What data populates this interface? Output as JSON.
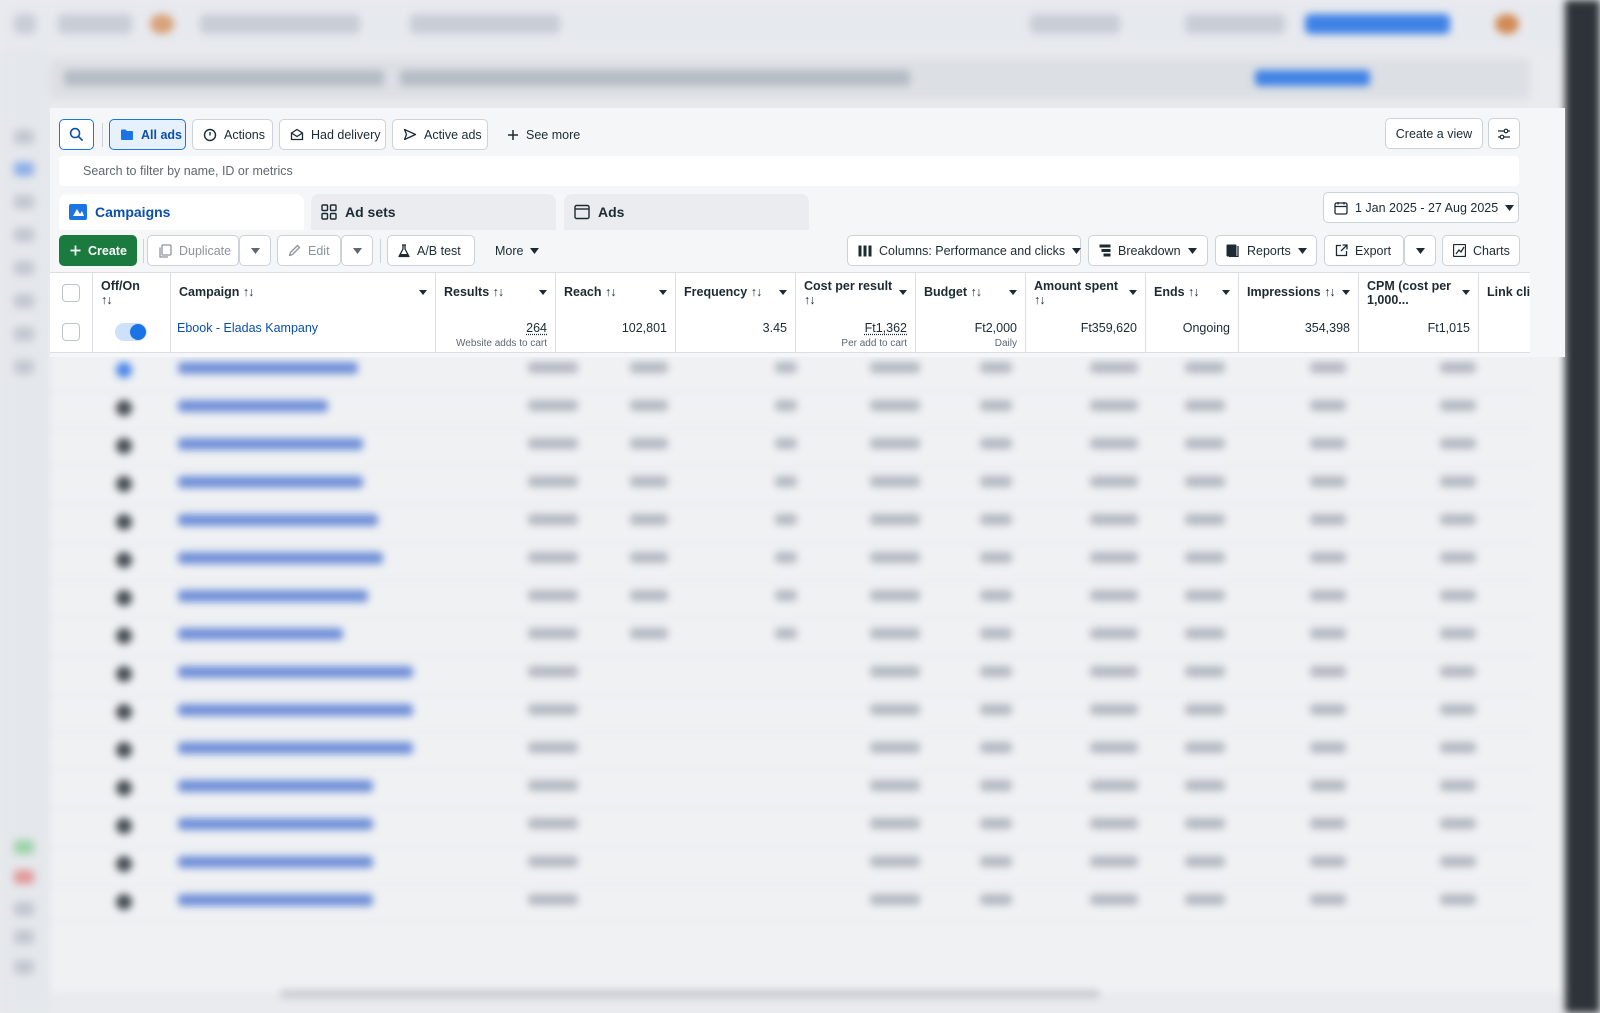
{
  "toolbar": {
    "all_ads": "All ads",
    "actions": "Actions",
    "had_delivery": "Had delivery",
    "active_ads": "Active ads",
    "see_more": "See more",
    "create_view": "Create a view"
  },
  "search": {
    "placeholder": "Search to filter by name, ID or metrics"
  },
  "tabs": {
    "campaigns": "Campaigns",
    "ad_sets": "Ad sets",
    "ads": "Ads"
  },
  "date_range": "1 Jan 2025 - 27 Aug 2025",
  "actions_bar": {
    "create": "Create",
    "duplicate": "Duplicate",
    "edit": "Edit",
    "ab_test": "A/B test",
    "more": "More",
    "columns": "Columns: Performance and clicks",
    "breakdown": "Breakdown",
    "reports": "Reports",
    "export": "Export",
    "charts": "Charts"
  },
  "table": {
    "headers": {
      "offon_1": "Off/On",
      "campaign": "Campaign",
      "results": "Results",
      "reach": "Reach",
      "frequency": "Frequency",
      "cost_per_result": "Cost per result",
      "budget": "Budget",
      "amount_spent": "Amount spent",
      "ends": "Ends",
      "impressions": "Impressions",
      "cpm_1": "CPM (cost per",
      "cpm_2": "1,000...",
      "link_clicks": "Link clic"
    },
    "row": {
      "toggle_on": true,
      "campaign": "Ebook - Eladas Kampany",
      "results": "264",
      "results_sub": "Website adds to cart",
      "reach": "102,801",
      "frequency": "3.45",
      "cost_per_result": "Ft1,362",
      "cost_per_result_sub": "Per add to cart",
      "budget": "Ft2,000",
      "budget_sub": "Daily",
      "amount_spent": "Ft359,620",
      "ends": "Ongoing",
      "impressions": "354,398",
      "cpm": "Ft1,015"
    }
  },
  "colors": {
    "accent": "#1b74e4",
    "create_green": "#1b7b3f",
    "link": "#0a4fab"
  }
}
